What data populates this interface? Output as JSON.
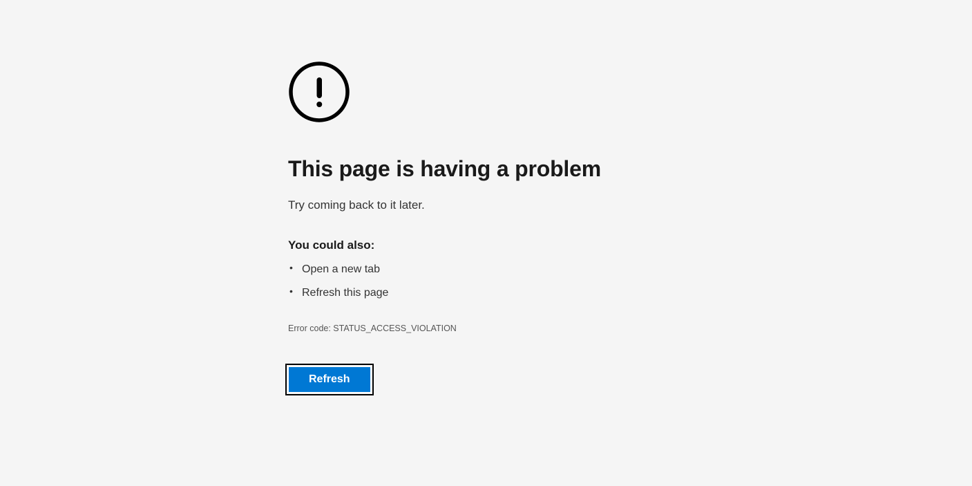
{
  "error": {
    "heading": "This page is having a problem",
    "subtext": "Try coming back to it later.",
    "subheading": "You could also:",
    "suggestions": [
      "Open a new tab",
      "Refresh this page"
    ],
    "error_code": "Error code: STATUS_ACCESS_VIOLATION",
    "refresh_label": "Refresh"
  }
}
